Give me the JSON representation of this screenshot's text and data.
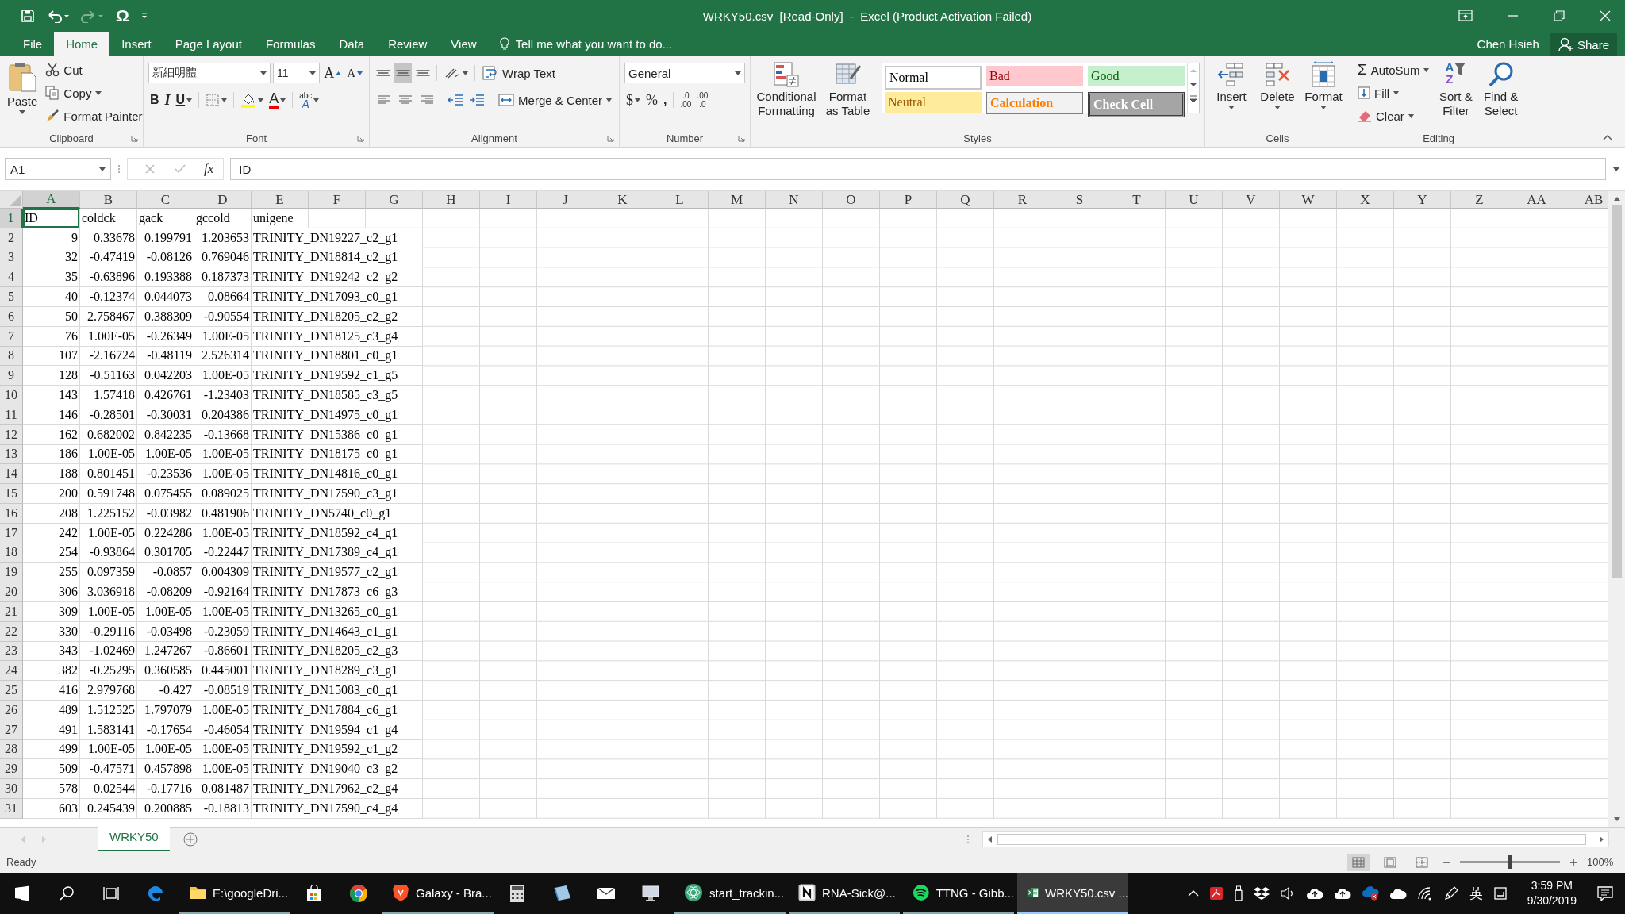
{
  "quick_access": {
    "omega": "Ω"
  },
  "title": "WRKY50.csv  [Read-Only]  -  Excel (Product Activation Failed)",
  "tabs": [
    {
      "label": "File",
      "selected": false
    },
    {
      "label": "Home",
      "selected": true
    },
    {
      "label": "Insert",
      "selected": false
    },
    {
      "label": "Page Layout",
      "selected": false
    },
    {
      "label": "Formulas",
      "selected": false
    },
    {
      "label": "Data",
      "selected": false
    },
    {
      "label": "Review",
      "selected": false
    },
    {
      "label": "View",
      "selected": false
    }
  ],
  "tell_me": {
    "placeholder": "Tell me what you want to do..."
  },
  "user": "Chen Hsieh",
  "share": "Share",
  "clipboard": {
    "paste": "Paste",
    "cut": "Cut",
    "copy": "Copy",
    "format_painter": "Format Painter",
    "label": "Clipboard"
  },
  "font": {
    "name": "新細明體",
    "size": "11",
    "grow": "A",
    "shrink": "A",
    "bold": "B",
    "italic": "I",
    "underline": "U",
    "font_color": "A",
    "phonetic_top": "abc",
    "phonetic_bottom": "A",
    "label": "Font"
  },
  "alignment": {
    "vertical": [
      {
        "selected": false
      },
      {
        "selected": true
      },
      {
        "selected": false
      }
    ],
    "wrap_text": "Wrap Text",
    "merge_center": "Merge & Center",
    "label": "Alignment"
  },
  "number": {
    "format": "General",
    "currency": "$",
    "percent": "%",
    "comma": ",",
    "increase_decimal": {
      "top": ".0",
      "bottom": ".00"
    },
    "decrease_decimal": {
      "top": ".00",
      "bottom": ".0"
    },
    "label": "Number"
  },
  "styles": {
    "conditional_formatting": "Conditional Formatting",
    "format_as_table": "Format as Table",
    "cell_styles": [
      {
        "label": "Normal",
        "kind": "normal"
      },
      {
        "label": "Bad",
        "kind": "bad"
      },
      {
        "label": "Good",
        "kind": "good"
      },
      {
        "label": "Neutral",
        "kind": "neutral"
      },
      {
        "label": "Calculation",
        "kind": "calculation"
      },
      {
        "label": "Check Cell",
        "kind": "check"
      }
    ],
    "label": "Styles"
  },
  "cells": {
    "buttons": [
      {
        "label": "Insert",
        "kind": "insert"
      },
      {
        "label": "Delete",
        "kind": "delete"
      },
      {
        "label": "Format",
        "kind": "format"
      }
    ],
    "label": "Cells"
  },
  "editing": {
    "sum_symbol": "Σ",
    "autosum": "AutoSum",
    "fill": "Fill",
    "clear": "Clear",
    "sort_letters": [
      "A",
      "Z"
    ],
    "sort_filter": "Sort & Filter",
    "find_select": "Find & Select",
    "label": "Editing"
  },
  "formula_bar": {
    "name_box": "A1",
    "fx": "fx",
    "value": "ID"
  },
  "columns": [
    {
      "label": "A",
      "kind": "number",
      "selected": true
    },
    {
      "label": "B",
      "kind": "number",
      "selected": false
    },
    {
      "label": "C",
      "kind": "number",
      "selected": false
    },
    {
      "label": "D",
      "kind": "number",
      "selected": false
    },
    {
      "label": "E",
      "kind": "text",
      "selected": false
    },
    {
      "label": "F",
      "selected": false
    },
    {
      "label": "G",
      "selected": false
    },
    {
      "label": "H",
      "selected": false
    },
    {
      "label": "I",
      "selected": false
    },
    {
      "label": "J",
      "selected": false
    },
    {
      "label": "K",
      "selected": false
    },
    {
      "label": "L",
      "selected": false
    },
    {
      "label": "M",
      "selected": false
    },
    {
      "label": "N",
      "selected": false
    },
    {
      "label": "O",
      "selected": false
    },
    {
      "label": "P",
      "selected": false
    },
    {
      "label": "Q",
      "selected": false
    },
    {
      "label": "R",
      "selected": false
    },
    {
      "label": "S",
      "selected": false
    },
    {
      "label": "T",
      "selected": false
    },
    {
      "label": "U",
      "selected": false
    },
    {
      "label": "V",
      "selected": false
    },
    {
      "label": "W",
      "selected": false
    },
    {
      "label": "X",
      "selected": false
    },
    {
      "label": "Y",
      "selected": false
    },
    {
      "label": "Z",
      "selected": false
    },
    {
      "label": "AA",
      "selected": false
    },
    {
      "label": "AB",
      "selected": false
    }
  ],
  "rows": [
    {
      "number": "1",
      "kind": "header",
      "selected": true,
      "cells": [
        "ID",
        "coldck",
        "gack",
        "gccold",
        "unigene"
      ]
    },
    {
      "number": "2",
      "kind": "data",
      "selected": false,
      "cells": [
        "9",
        "0.33678",
        "0.199791",
        "1.203653",
        "TRINITY_DN19227_c2_g1"
      ]
    },
    {
      "number": "3",
      "kind": "data",
      "selected": false,
      "cells": [
        "32",
        "-0.47419",
        "-0.08126",
        "0.769046",
        "TRINITY_DN18814_c2_g1"
      ]
    },
    {
      "number": "4",
      "kind": "data",
      "selected": false,
      "cells": [
        "35",
        "-0.63896",
        "0.193388",
        "0.187373",
        "TRINITY_DN19242_c2_g2"
      ]
    },
    {
      "number": "5",
      "kind": "data",
      "selected": false,
      "cells": [
        "40",
        "-0.12374",
        "0.044073",
        "0.08664",
        "TRINITY_DN17093_c0_g1"
      ]
    },
    {
      "number": "6",
      "kind": "data",
      "selected": false,
      "cells": [
        "50",
        "2.758467",
        "0.388309",
        "-0.90554",
        "TRINITY_DN18205_c2_g2"
      ]
    },
    {
      "number": "7",
      "kind": "data",
      "selected": false,
      "cells": [
        "76",
        "1.00E-05",
        "-0.26349",
        "1.00E-05",
        "TRINITY_DN18125_c3_g4"
      ]
    },
    {
      "number": "8",
      "kind": "data",
      "selected": false,
      "cells": [
        "107",
        "-2.16724",
        "-0.48119",
        "2.526314",
        "TRINITY_DN18801_c0_g1"
      ]
    },
    {
      "number": "9",
      "kind": "data",
      "selected": false,
      "cells": [
        "128",
        "-0.51163",
        "0.042203",
        "1.00E-05",
        "TRINITY_DN19592_c1_g5"
      ]
    },
    {
      "number": "10",
      "kind": "data",
      "selected": false,
      "cells": [
        "143",
        "1.57418",
        "0.426761",
        "-1.23403",
        "TRINITY_DN18585_c3_g5"
      ]
    },
    {
      "number": "11",
      "kind": "data",
      "selected": false,
      "cells": [
        "146",
        "-0.28501",
        "-0.30031",
        "0.204386",
        "TRINITY_DN14975_c0_g1"
      ]
    },
    {
      "number": "12",
      "kind": "data",
      "selected": false,
      "cells": [
        "162",
        "0.682002",
        "0.842235",
        "-0.13668",
        "TRINITY_DN15386_c0_g1"
      ]
    },
    {
      "number": "13",
      "kind": "data",
      "selected": false,
      "cells": [
        "186",
        "1.00E-05",
        "1.00E-05",
        "1.00E-05",
        "TRINITY_DN18175_c0_g1"
      ]
    },
    {
      "number": "14",
      "kind": "data",
      "selected": false,
      "cells": [
        "188",
        "0.801451",
        "-0.23536",
        "1.00E-05",
        "TRINITY_DN14816_c0_g1"
      ]
    },
    {
      "number": "15",
      "kind": "data",
      "selected": false,
      "cells": [
        "200",
        "0.591748",
        "0.075455",
        "0.089025",
        "TRINITY_DN17590_c3_g1"
      ]
    },
    {
      "number": "16",
      "kind": "data",
      "selected": false,
      "cells": [
        "208",
        "1.225152",
        "-0.03982",
        "0.481906",
        "TRINITY_DN5740_c0_g1"
      ]
    },
    {
      "number": "17",
      "kind": "data",
      "selected": false,
      "cells": [
        "242",
        "1.00E-05",
        "0.224286",
        "1.00E-05",
        "TRINITY_DN18592_c4_g1"
      ]
    },
    {
      "number": "18",
      "kind": "data",
      "selected": false,
      "cells": [
        "254",
        "-0.93864",
        "0.301705",
        "-0.22447",
        "TRINITY_DN17389_c4_g1"
      ]
    },
    {
      "number": "19",
      "kind": "data",
      "selected": false,
      "cells": [
        "255",
        "0.097359",
        "-0.0857",
        "0.004309",
        "TRINITY_DN19577_c2_g1"
      ]
    },
    {
      "number": "20",
      "kind": "data",
      "selected": false,
      "cells": [
        "306",
        "3.036918",
        "-0.08209",
        "-0.92164",
        "TRINITY_DN17873_c6_g3"
      ]
    },
    {
      "number": "21",
      "kind": "data",
      "selected": false,
      "cells": [
        "309",
        "1.00E-05",
        "1.00E-05",
        "1.00E-05",
        "TRINITY_DN13265_c0_g1"
      ]
    },
    {
      "number": "22",
      "kind": "data",
      "selected": false,
      "cells": [
        "330",
        "-0.29116",
        "-0.03498",
        "-0.23059",
        "TRINITY_DN14643_c1_g1"
      ]
    },
    {
      "number": "23",
      "kind": "data",
      "selected": false,
      "cells": [
        "343",
        "-1.02469",
        "1.247267",
        "-0.86601",
        "TRINITY_DN18205_c2_g3"
      ]
    },
    {
      "number": "24",
      "kind": "data",
      "selected": false,
      "cells": [
        "382",
        "-0.25295",
        "0.360585",
        "0.445001",
        "TRINITY_DN18289_c3_g1"
      ]
    },
    {
      "number": "25",
      "kind": "data",
      "selected": false,
      "cells": [
        "416",
        "2.979768",
        "-0.427",
        "-0.08519",
        "TRINITY_DN15083_c0_g1"
      ]
    },
    {
      "number": "26",
      "kind": "data",
      "selected": false,
      "cells": [
        "489",
        "1.512525",
        "1.797079",
        "1.00E-05",
        "TRINITY_DN17884_c6_g1"
      ]
    },
    {
      "number": "27",
      "kind": "data",
      "selected": false,
      "cells": [
        "491",
        "1.583141",
        "-0.17654",
        "-0.46054",
        "TRINITY_DN19594_c1_g4"
      ]
    },
    {
      "number": "28",
      "kind": "data",
      "selected": false,
      "cells": [
        "499",
        "1.00E-05",
        "1.00E-05",
        "1.00E-05",
        "TRINITY_DN19592_c1_g2"
      ]
    },
    {
      "number": "29",
      "kind": "data",
      "selected": false,
      "cells": [
        "509",
        "-0.47571",
        "0.457898",
        "1.00E-05",
        "TRINITY_DN19040_c3_g2"
      ]
    },
    {
      "number": "30",
      "kind": "data",
      "selected": false,
      "cells": [
        "578",
        "0.02544",
        "-0.17716",
        "0.081487",
        "TRINITY_DN17962_c2_g4"
      ]
    },
    {
      "number": "31",
      "kind": "data",
      "selected": false,
      "cells": [
        "603",
        "0.245439",
        "0.200885",
        "-0.18813",
        "TRINITY_DN17590_c4_g4"
      ]
    }
  ],
  "sheet_tabs": [
    {
      "label": "WRKY50",
      "selected": true
    }
  ],
  "status": "Ready",
  "views": [
    {
      "kind": "normal",
      "selected": true
    },
    {
      "kind": "page_layout",
      "selected": false
    },
    {
      "kind": "page_break",
      "selected": false
    }
  ],
  "zoom": {
    "level": 0.5,
    "reading": "100%"
  },
  "taskbar": [
    {
      "kind": "start",
      "active": false
    },
    {
      "kind": "search",
      "active": false
    },
    {
      "kind": "taskview",
      "active": false
    },
    {
      "kind": "edge",
      "active": false
    },
    {
      "kind": "folder",
      "label": "E:\\googleDri...",
      "active": false
    },
    {
      "kind": "store",
      "active": false
    },
    {
      "kind": "chrome",
      "active": false
    },
    {
      "kind": "brave",
      "label": "Galaxy - Bra...",
      "active": false
    },
    {
      "kind": "calculator",
      "active": false
    },
    {
      "kind": "notebook",
      "active": false
    },
    {
      "kind": "mail",
      "active": false
    },
    {
      "kind": "monitor",
      "active": false
    },
    {
      "kind": "atom",
      "label": "start_trackin...",
      "active": false
    },
    {
      "kind": "notion",
      "label": "RNA-Sick@...",
      "active": false
    },
    {
      "kind": "spotify",
      "label": "TTNG - Gibb...",
      "active": false
    },
    {
      "kind": "excel",
      "label": "WRKY50.csv ...",
      "active": true
    }
  ],
  "tray": {
    "ime": "英",
    "time": "3:59 PM",
    "date": "9/30/2019"
  }
}
